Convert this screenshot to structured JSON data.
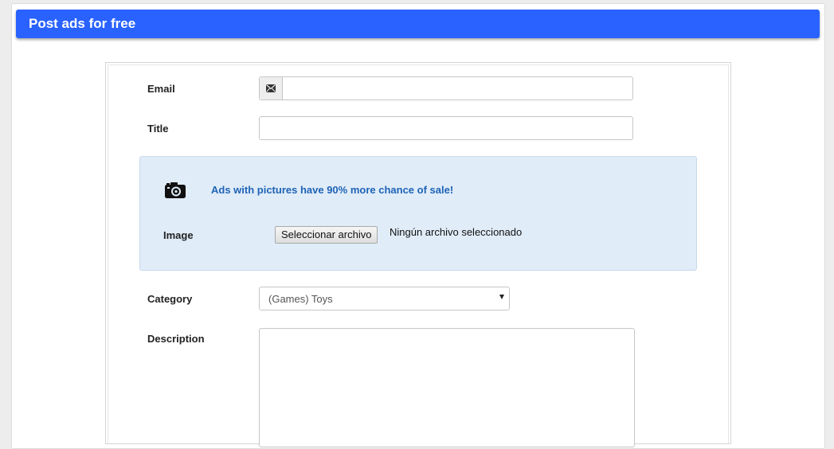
{
  "header": {
    "title": "Post ads for free"
  },
  "form": {
    "email_label": "Email",
    "email_value": "",
    "title_label": "Title",
    "title_value": "",
    "image_panel": {
      "promo_text": "Ads with pictures have 90% more chance of sale!",
      "image_label": "Image",
      "file_button_label": "Seleccionar archivo",
      "file_status": "Ningún archivo seleccionado"
    },
    "category_label": "Category",
    "category_selected": "(Games) Toys",
    "description_label": "Description",
    "description_value": ""
  },
  "icons": {
    "email": "envelope-icon",
    "camera": "camera-icon",
    "select": "caret-down-icon"
  },
  "colors": {
    "header_bg": "#2962ff",
    "header_text": "#ffffff",
    "panel_bg": "#e0ecf8",
    "promo_text": "#1e63b6"
  }
}
